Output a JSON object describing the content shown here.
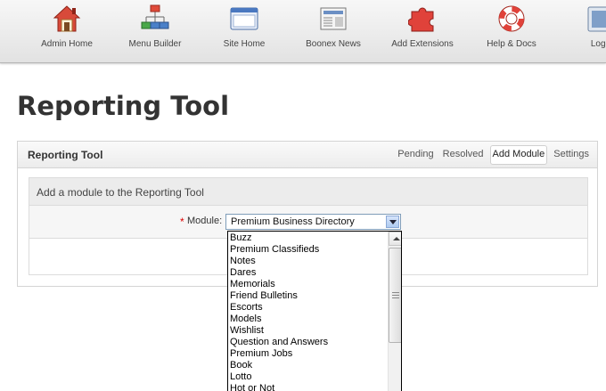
{
  "toolbar": {
    "items": [
      {
        "label": "Admin Home",
        "icon": "house-icon"
      },
      {
        "label": "Menu Builder",
        "icon": "sitemap-icon"
      },
      {
        "label": "Site Home",
        "icon": "browser-window-icon"
      },
      {
        "label": "Boonex News",
        "icon": "newspaper-icon"
      },
      {
        "label": "Add Extensions",
        "icon": "puzzle-piece-icon"
      },
      {
        "label": "Help & Docs",
        "icon": "lifebuoy-icon"
      },
      {
        "label": "Logo",
        "icon": "logout-icon"
      }
    ]
  },
  "page": {
    "title": "Reporting Tool"
  },
  "panel": {
    "title": "Reporting Tool",
    "tabs": [
      {
        "label": "Pending"
      },
      {
        "label": "Resolved"
      },
      {
        "label": "Add Module",
        "active": true
      },
      {
        "label": "Settings"
      }
    ],
    "section_title": "Add a module to the Reporting Tool",
    "module_field": {
      "required_mark": "*",
      "label": "Module:",
      "selected": "Premium Business Directory",
      "options": [
        "Buzz",
        "Premium Classifieds",
        "Notes",
        "Dares",
        "Memorials",
        "Friend Bulletins",
        "Escorts",
        "Models",
        "Wishlist",
        "Question and Answers",
        "Premium Jobs",
        "Book",
        "Lotto",
        "Hot or Not"
      ]
    }
  },
  "colors": {
    "required": "#dd0000",
    "select_border": "#7f9db9",
    "page_text": "#333333"
  }
}
